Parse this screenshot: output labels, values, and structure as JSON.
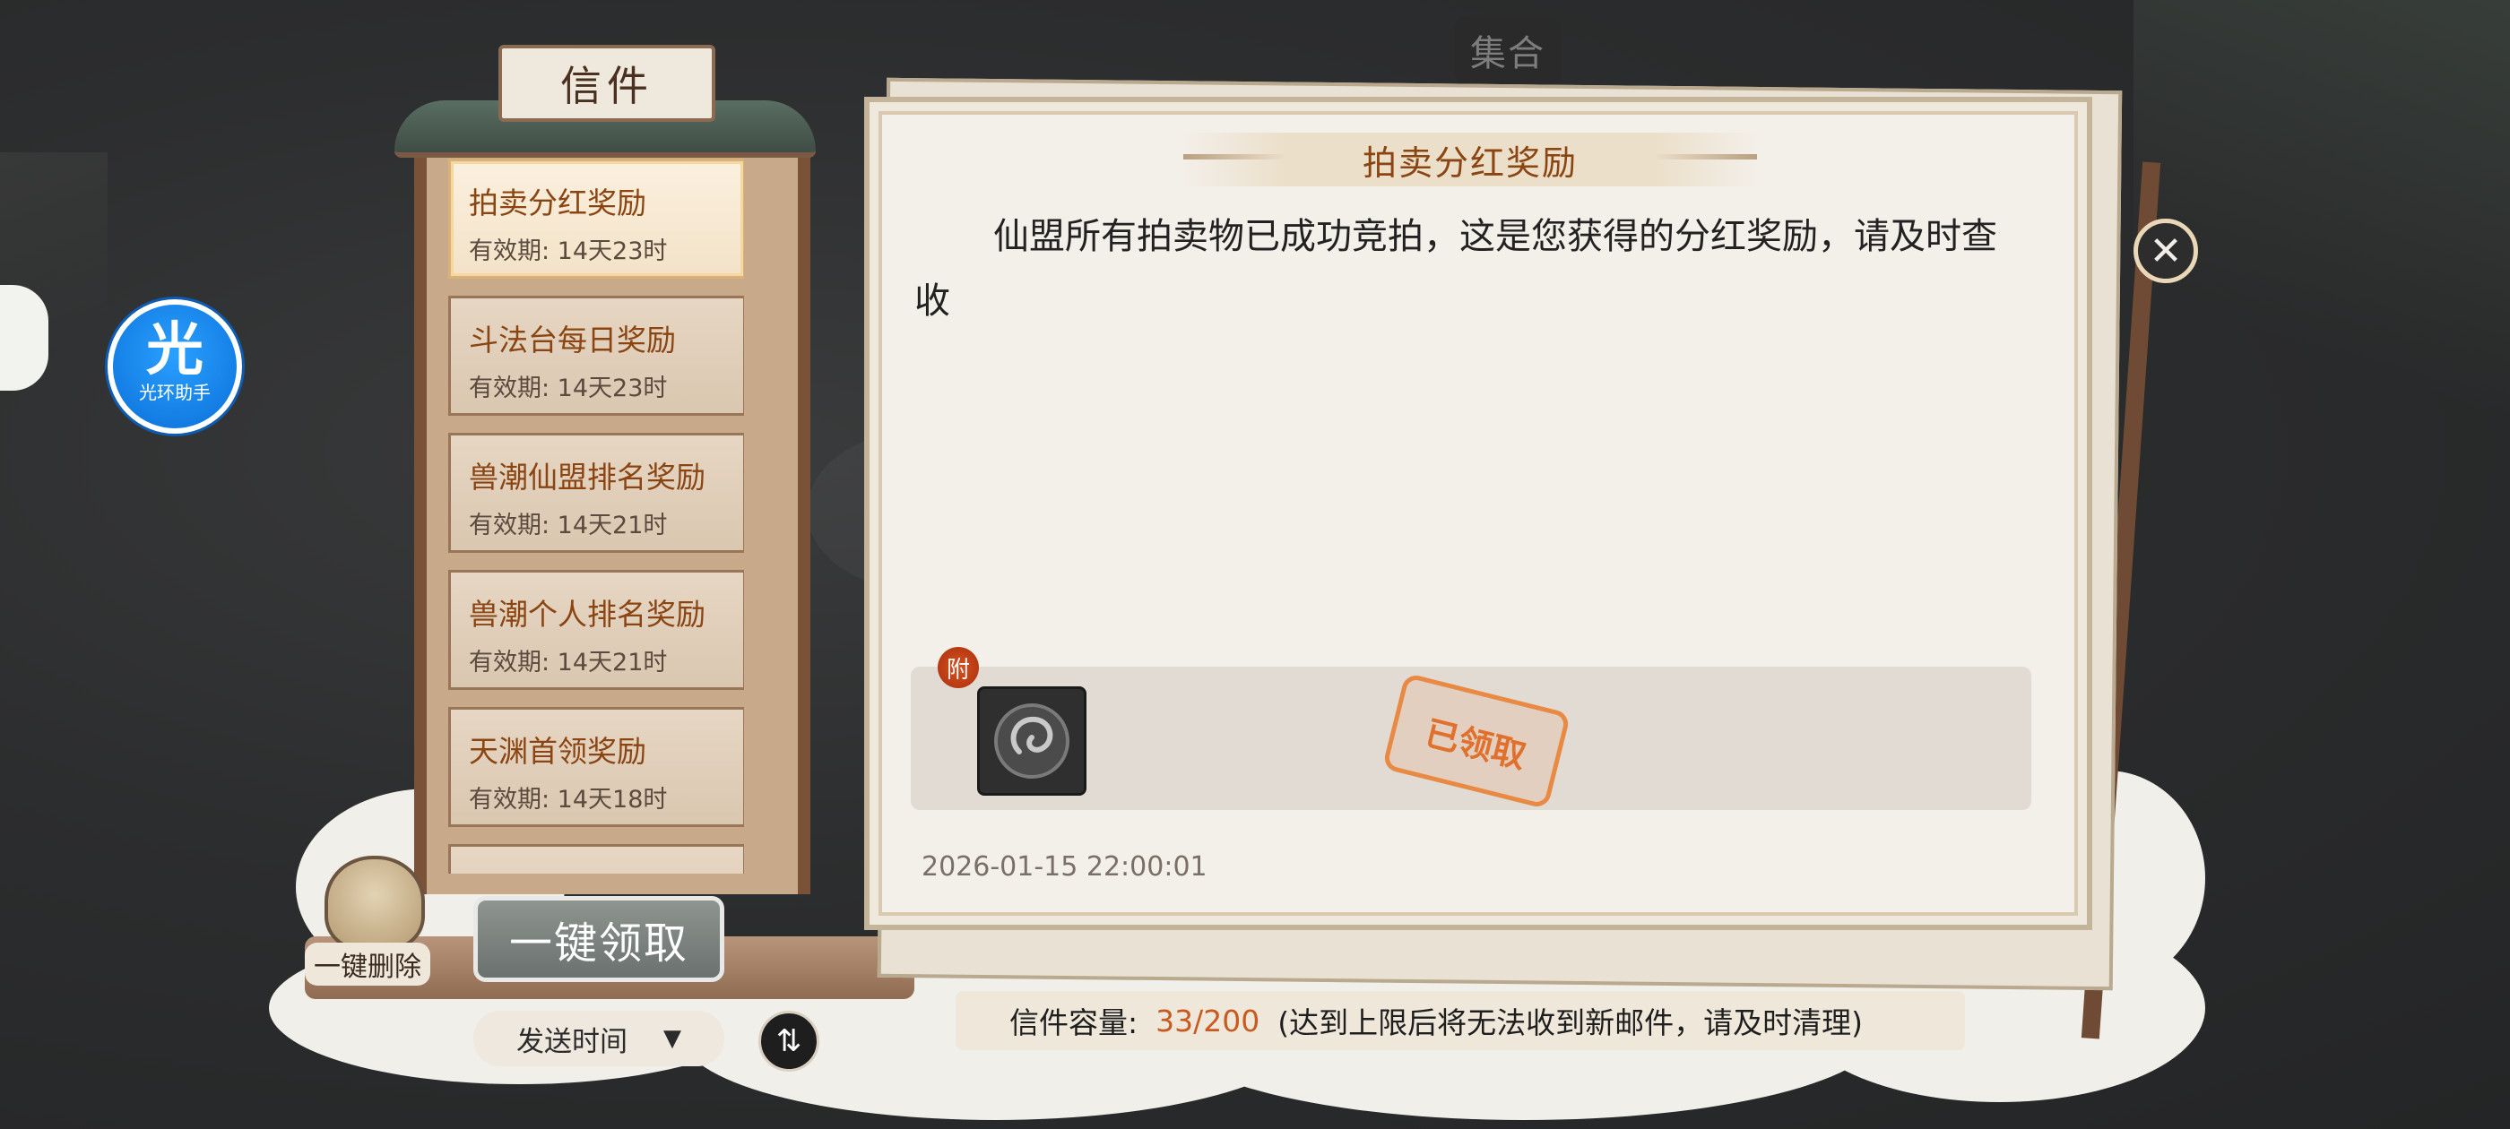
{
  "top_tab": {
    "label": "集合"
  },
  "assistant": {
    "glyph": "光",
    "label": "光环助手"
  },
  "mail_panel": {
    "title": "信件",
    "items": [
      {
        "title": "拍卖分红奖励",
        "expiry": "有效期: 14天23时",
        "selected": true
      },
      {
        "title": "斗法台每日奖励",
        "expiry": "有效期: 14天23时",
        "selected": false
      },
      {
        "title": "兽潮仙盟排名奖励",
        "expiry": "有效期: 14天21时",
        "selected": false
      },
      {
        "title": "兽潮个人排名奖励",
        "expiry": "有效期: 14天21时",
        "selected": false
      },
      {
        "title": "天渊首领奖励",
        "expiry": "有效期: 14天18时",
        "selected": false
      }
    ],
    "delete_all_label": "一键删除",
    "claim_all_label": "一键领取",
    "sort_label": "发送时间",
    "sort_arrow": "▼",
    "swap_glyph": "⇅"
  },
  "detail": {
    "title": "拍卖分红奖励",
    "body": "仙盟所有拍卖物已成功竞拍，这是您获得的分红奖励，请及时查收",
    "attachment_badge": "附",
    "claimed_stamp": "已领取",
    "date": "2026-01-15 22:00:01",
    "close_glyph": "✕"
  },
  "capacity": {
    "label": "信件容量:",
    "value": "33/200",
    "note": "(达到上限后将无法收到新邮件，请及时清理)"
  },
  "colors": {
    "accent_brown": "#8b4513",
    "capacity_value": "#c85a20",
    "stamp": "#e0702c"
  }
}
